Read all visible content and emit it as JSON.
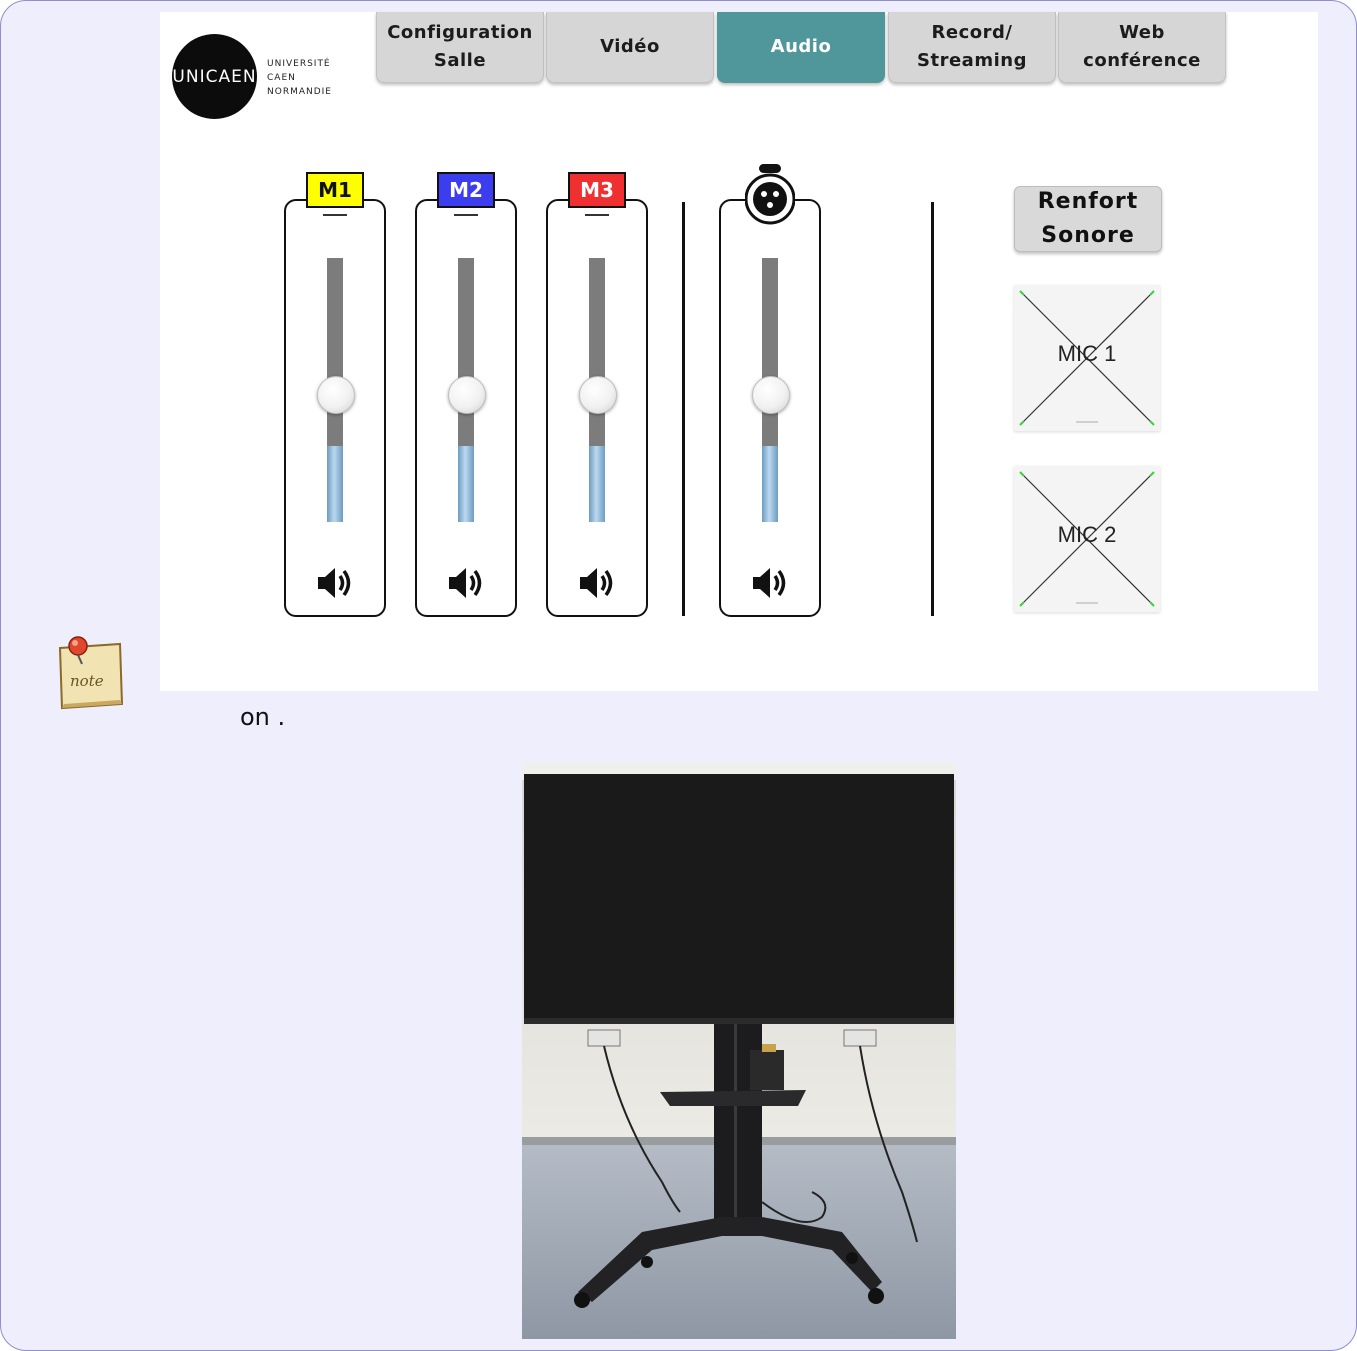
{
  "logo": {
    "mark": "UNICAEN",
    "lines": [
      "UNIVERSITÉ",
      "CAEN",
      "NORMANDIE"
    ]
  },
  "tabs": [
    {
      "label": "Configuration\nSalle",
      "active": false
    },
    {
      "label": "Vidéo",
      "active": false
    },
    {
      "label": "Audio",
      "active": true
    },
    {
      "label": "Record/\nStreaming",
      "active": false
    },
    {
      "label": "Web\nconférence",
      "active": false
    }
  ],
  "channels": [
    {
      "label": "M1",
      "color": "#ffff00",
      "level": 0.5,
      "icon": "speaker-icon"
    },
    {
      "label": "M2",
      "color": "#3d3df0",
      "level": 0.5,
      "icon": "speaker-icon"
    },
    {
      "label": "M3",
      "color": "#f03030",
      "level": 0.5,
      "icon": "speaker-icon"
    },
    {
      "label": "",
      "icon": "xlr-connector-icon",
      "level": 0.5
    }
  ],
  "renfort": {
    "label": "Renfort\nSonore"
  },
  "mics": [
    {
      "label": "MIC 1"
    },
    {
      "label": "MIC 2"
    }
  ],
  "caption": "on .",
  "colors": {
    "background": "#eeeefc",
    "active_tab": "#4f979b",
    "tab": "#d6d6d6",
    "fader_fill": "#8fb8dc"
  }
}
